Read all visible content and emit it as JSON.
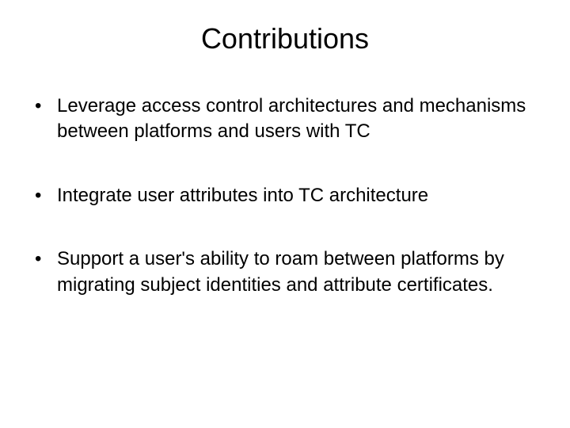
{
  "title": "Contributions",
  "bullets": [
    "Leverage access control architectures and mechanisms between platforms and users with TC",
    "Integrate user attributes into TC architecture",
    "Support a user's ability to roam between platforms by migrating subject identities and attribute certificates."
  ]
}
